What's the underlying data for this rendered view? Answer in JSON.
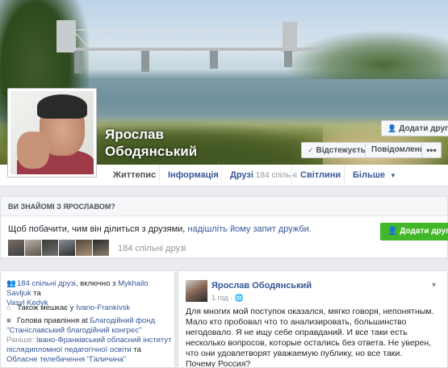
{
  "profile": {
    "name_line1": "Ярослав",
    "name_line2": "Ободянський"
  },
  "cover_actions": {
    "add_friend": "Додати друга",
    "following": "Відстежується",
    "message": "Повідомлення",
    "more": "•••"
  },
  "tabs": [
    {
      "label": "Життепис",
      "active": true
    },
    {
      "label": "Інформація"
    },
    {
      "label": "Друзі",
      "count": "184 спільні"
    },
    {
      "label": "Світлини"
    },
    {
      "label": "Більше"
    }
  ],
  "know_box": {
    "header": "ВИ ЗНАЙОМІ З ЯРОСЛАВОМ?",
    "text_prefix": "Щоб побачити, чим він ділиться з друзями, ",
    "text_link": "надішліть йому запит дружби.",
    "add_button": "Додати друга",
    "mutual_count": "184 спільні друзі"
  },
  "intro": {
    "mutual_link": "184 спільні друзі",
    "mutual_mid": ", включно з ",
    "mutual_name1": "Mykhailo Savljuk",
    "mutual_and": " та",
    "mutual_name2": "Vasyl Kedyk",
    "lives_prefix": "Також мешкає у ",
    "lives_link": "Ivano-Frankivsk",
    "work_prefix": "Голова правління at ",
    "work_link": "Благодійний фонд \"Станіславський благодійний конгрес\"",
    "past_prefix": "Раніше: ",
    "past_link1": "Івано-Франківський обласний інститут післядипломної педагогічної освіти",
    "past_and": " та ",
    "past_link2": "Обласне телебачення \"Галичина\""
  },
  "post": {
    "author": "Ярослав Ободянський",
    "time": "1 год · ",
    "line1": "Для многих мой поступок оказался, мягко говоря, непонятным. Мало кто пробовал что то анализировать, большинство негодовало. Я не ищу себе оправданий. И все таки есть несколько вопросов, которые остались без ответа. Не уверен, что они удовлетворят уважаемую публику, но все таки.",
    "line2": "Почему Россия?"
  },
  "colors": {
    "link": "#365899",
    "green_button": "#42b72a",
    "background": "#e9ebee"
  }
}
